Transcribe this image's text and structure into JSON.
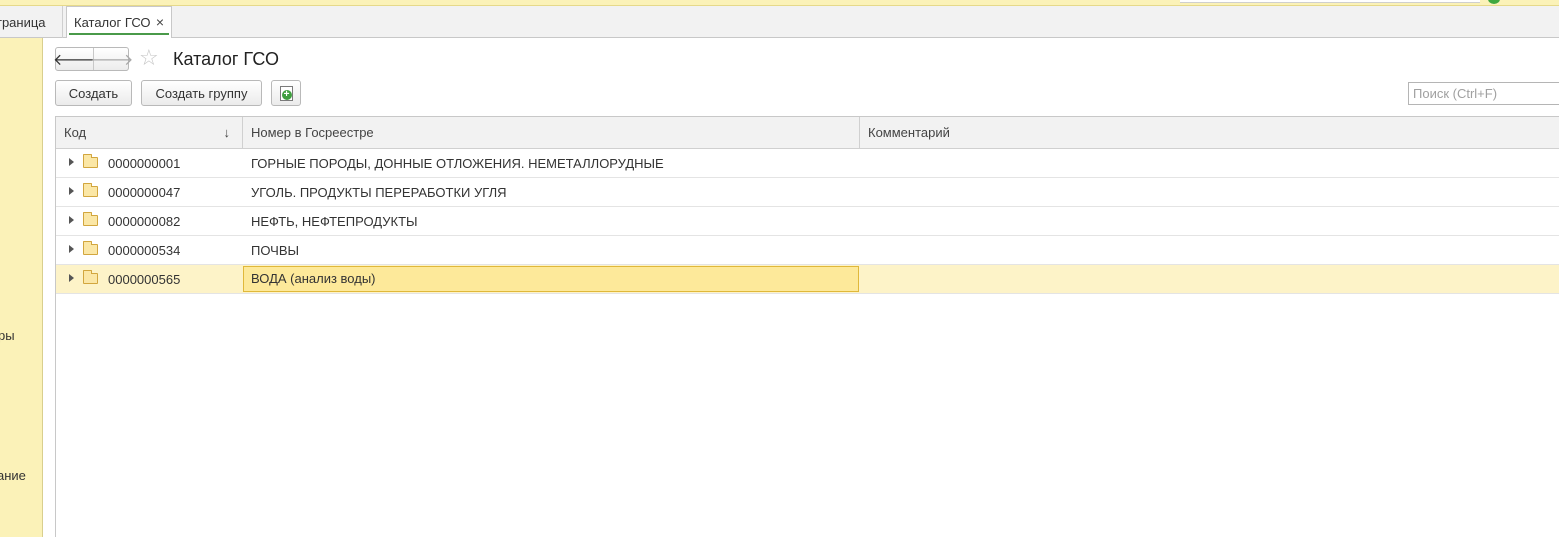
{
  "tabs": {
    "home_label": "траница",
    "active_label": "Каталог ГСО",
    "close_glyph": "×"
  },
  "left_panel": {
    "fragments": [
      "ры",
      "ание"
    ]
  },
  "header": {
    "title": "Каталог ГСО",
    "back_glyph": "🡐",
    "forward_glyph": "🡒",
    "star_glyph": "☆"
  },
  "toolbar": {
    "create_label": "Создать",
    "create_group_label": "Создать группу",
    "search_placeholder": "Поиск (Ctrl+F)"
  },
  "table": {
    "columns": {
      "code": "Код",
      "registry_number": "Номер в Госреестре",
      "comment": "Комментарий"
    },
    "sort_glyph": "↓",
    "rows": [
      {
        "code": "0000000001",
        "registry_number": "ГОРНЫЕ ПОРОДЫ,  ДОННЫЕ ОТЛОЖЕНИЯ. НЕМЕТАЛЛОРУДНЫЕ",
        "comment": ""
      },
      {
        "code": "0000000047",
        "registry_number": "УГОЛЬ. ПРОДУКТЫ ПЕРЕРАБОТКИ УГЛЯ",
        "comment": ""
      },
      {
        "code": "0000000082",
        "registry_number": "НЕФТЬ,  НЕФТЕПРОДУКТЫ",
        "comment": ""
      },
      {
        "code": "0000000534",
        "registry_number": "ПОЧВЫ",
        "comment": ""
      },
      {
        "code": "0000000565",
        "registry_number": "ВОДА (анализ воды)",
        "comment": "",
        "selected": true
      }
    ]
  },
  "colors": {
    "panel_yellow": "#fbf2b8",
    "selected_row": "#fdf3c8",
    "selected_cell": "#fde99a",
    "accent_green": "#4a9a4a"
  }
}
